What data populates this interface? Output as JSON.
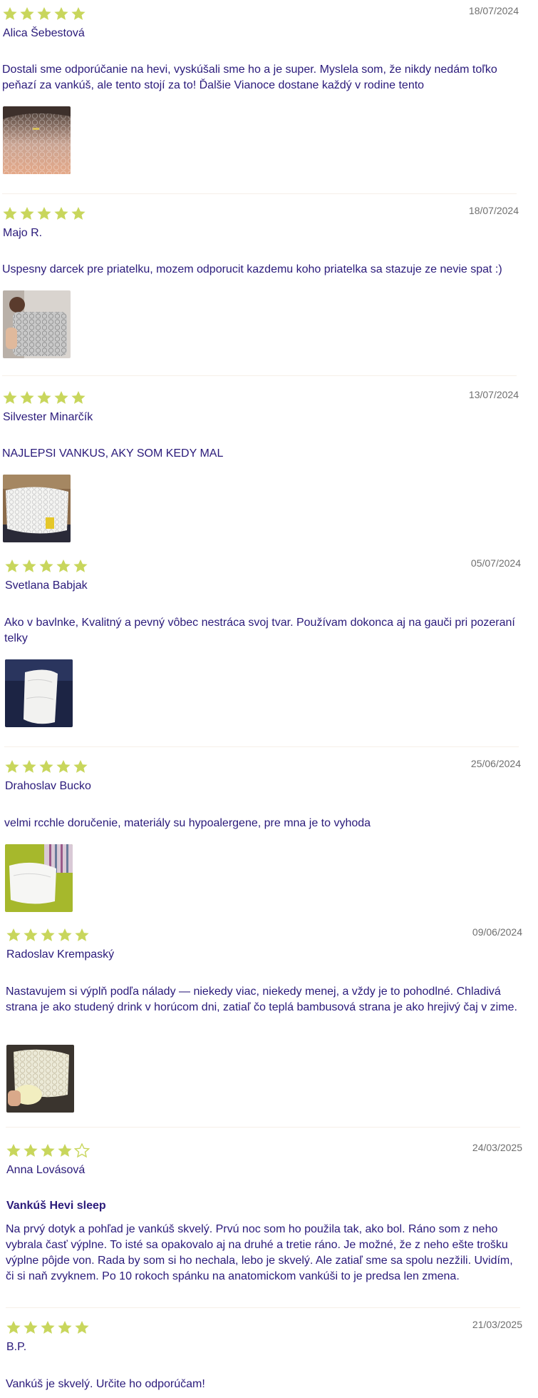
{
  "icons": {
    "star_filled": "star-filled-icon",
    "star_empty": "star-empty-icon"
  },
  "colors": {
    "star": "#c8d65c",
    "text": "#2a1a7a",
    "date": "#6f6f6f"
  },
  "reviews": [
    {
      "rating": 5,
      "date": "18/07/2024",
      "author": "Alica Šebestová",
      "title": "",
      "body": "Dostali sme odporúčanie na hevi, vyskúšali sme ho a je super. Myslela som, že nikdy nedám toľko peňazí za vankúš, ale tento stojí za to! Ďalšie Vianoce dostane každý v rodine tento",
      "image": "pillow-closeup-photo"
    },
    {
      "rating": 5,
      "date": "18/07/2024",
      "author": "Majo R.",
      "title": "",
      "body": "Uspesny darcek pre priatelku, mozem odporucit kazdemu koho priatelka sa stazuje ze nevie spat :)",
      "image": "person-holding-pillow-photo"
    },
    {
      "rating": 5,
      "date": "13/07/2024",
      "author": "Silvester Minarčík",
      "title": "",
      "body": "NAJLEPSI VANKUS, AKY SOM KEDY MAL",
      "image": "pillow-on-bed-photo"
    },
    {
      "rating": 5,
      "date": "05/07/2024",
      "author": "Svetlana Babjak",
      "title": "",
      "body": "Ako v bavlnke, Kvalitný a pevný vôbec nestráca svoj tvar. Používam dokonca aj na gauči pri pozeraní telky",
      "image": "pillow-on-sofa-photo"
    },
    {
      "rating": 5,
      "date": "25/06/2024",
      "author": "Drahoslav Bucko",
      "title": "",
      "body": "velmi rcchle doručenie, materiály su hypoalergene, pre mna je to vyhoda",
      "image": "pillow-on-green-sheet-photo"
    },
    {
      "rating": 5,
      "date": "09/06/2024",
      "author": "Radoslav Krempaský",
      "title": "",
      "body": "Nastavujem si výplň podľa nálady — niekedy viac, niekedy menej, a vždy je to pohodlné. Chladivá strana je ako studený drink v horúcom dni, zatiaľ čo teplá bambusová strana je ako hrejivý čaj v zime.",
      "image": "pillow-filling-photo"
    },
    {
      "rating": 4,
      "date": "24/03/2025",
      "author": "Anna Lovásová",
      "title": "Vankúš Hevi sleep",
      "body": "Na prvý dotyk a pohľad je vankúš skvelý. Prvú noc som ho použila tak, ako bol. Ráno som z neho vybrala časť výplne. To isté sa opakovalo aj na druhé a tretie ráno. Je možné, že z neho ešte trošku výplne pôjde von. Rada by som si ho nechala, lebo je skvelý. Ale zatiaľ sme sa spolu nezžili. Uvidím, či si naň zvyknem. Po 10 rokoch spánku na anatomickom vankúši to je predsa len zmena.",
      "image": ""
    },
    {
      "rating": 5,
      "date": "21/03/2025",
      "author": "B.P.",
      "title": "",
      "body": "Vankúš je skvelý. Určite ho odporúčam!",
      "image": ""
    }
  ]
}
